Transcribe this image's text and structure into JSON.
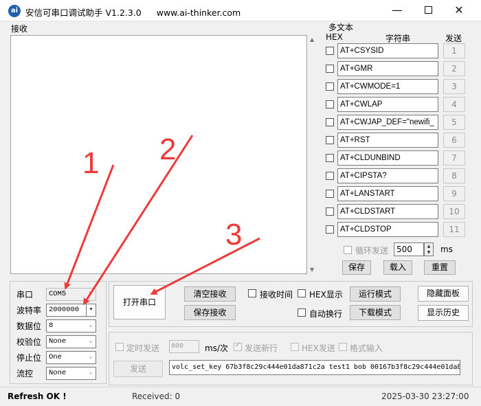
{
  "window": {
    "title": "安信可串口调试助手 V1.2.3.0",
    "url": "www.ai-thinker.com",
    "minimize": "—",
    "close": "✕"
  },
  "receive": {
    "label": "接收"
  },
  "multitext": {
    "title": "多文本",
    "hex_header": "HEX",
    "string_header": "字符串",
    "send_header": "发送",
    "rows": [
      {
        "cmd": "AT+CSYSID",
        "num": "1"
      },
      {
        "cmd": "AT+GMR",
        "num": "2"
      },
      {
        "cmd": "AT+CWMODE=1",
        "num": "3"
      },
      {
        "cmd": "AT+CWLAP",
        "num": "4"
      },
      {
        "cmd": "AT+CWJAP_DEF=\"newifi_",
        "num": "5"
      },
      {
        "cmd": "AT+RST",
        "num": "6"
      },
      {
        "cmd": "AT+CLDUNBIND",
        "num": "7"
      },
      {
        "cmd": "AT+CIPSTA?",
        "num": "8"
      },
      {
        "cmd": "AT+LANSTART",
        "num": "9"
      },
      {
        "cmd": "AT+CLDSTART",
        "num": "10"
      },
      {
        "cmd": "AT+CLDSTOP",
        "num": "11"
      }
    ],
    "loop_label": "循环发送",
    "loop_value": "500",
    "loop_unit": "ms",
    "save": "保存",
    "load": "载入",
    "reset": "重置"
  },
  "serial": {
    "port_label": "串口",
    "port_value": "COM5",
    "baud_label": "波特率",
    "baud_value": "2000000",
    "databits_label": "数据位",
    "databits_value": "8",
    "parity_label": "校验位",
    "parity_value": "None",
    "stopbits_label": "停止位",
    "stopbits_value": "One",
    "flow_label": "流控",
    "flow_value": "None"
  },
  "controls": {
    "open_port": "打开串口",
    "clear_recv": "清空接收",
    "save_recv": "保存接收",
    "recv_time": "接收时间",
    "hex_display": "HEX显示",
    "auto_wrap": "自动换行",
    "run_mode": "运行模式",
    "download_mode": "下载模式",
    "hide_panel": "隐藏面板",
    "show_history": "显示历史"
  },
  "send": {
    "timed_send": "定时发送",
    "period_value": "800",
    "period_unit": "ms/次",
    "send_newline": "发送新行",
    "hex_send": "HEX发送",
    "format_input": "格式输入",
    "send_button": "发送",
    "input_value": "volc_set_key 67b3f8c29c444e01da871c2a test1 bob 00167b3f8c29c444e01da8"
  },
  "status": {
    "left": "Refresh OK !",
    "received": "Received: 0",
    "datetime": "2025-03-30 23:27:00"
  },
  "annotations": {
    "labels": [
      "1",
      "2",
      "3"
    ],
    "arrow_color": "#ef3a3a"
  }
}
